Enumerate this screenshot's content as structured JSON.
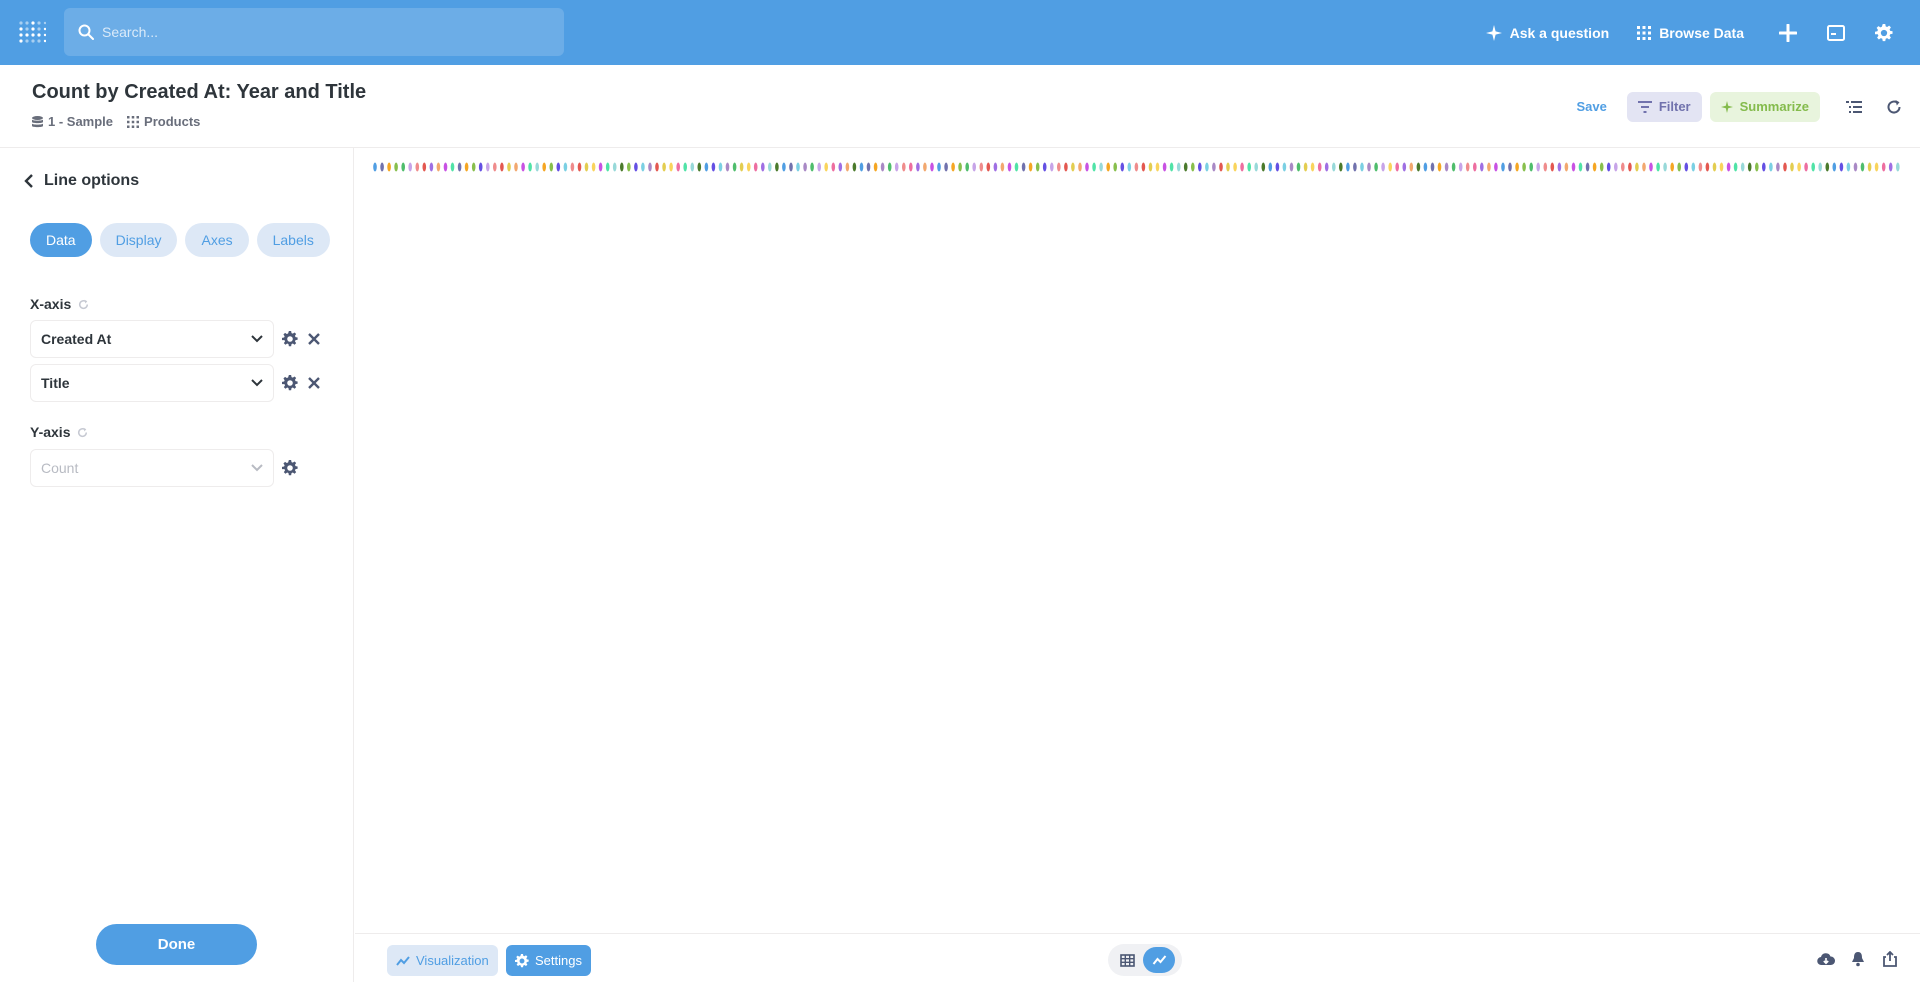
{
  "app": {
    "search_placeholder": "Search...",
    "ask_question": "Ask a question",
    "browse_data": "Browse Data",
    "brand_color": "#509ee3"
  },
  "question": {
    "title": "Count by Created At: Year and Title",
    "database": "1 - Sample",
    "table": "Products",
    "save_label": "Save",
    "filter_label": "Filter",
    "summarize_label": "Summarize"
  },
  "sidebar": {
    "heading": "Line options",
    "tabs": [
      {
        "label": "Data",
        "active": true
      },
      {
        "label": "Display",
        "active": false
      },
      {
        "label": "Axes",
        "active": false
      },
      {
        "label": "Labels",
        "active": false
      }
    ],
    "x_axis_label": "X-axis",
    "x_axis_fields": [
      "Created At",
      "Title"
    ],
    "y_axis_label": "Y-axis",
    "y_axis_field": "Count",
    "done_label": "Done"
  },
  "footer": {
    "visualization_label": "Visualization",
    "settings_label": "Settings"
  },
  "legend": {
    "colors": [
      "#509ee3",
      "#88bf4d",
      "#a989c5",
      "#ef8c8c",
      "#f9d45c",
      "#f2a86f",
      "#98d9d9",
      "#7172ad",
      "#6450e3",
      "#4fbd6c",
      "#e35850",
      "#ed6ea0",
      "#c852e3",
      "#4b7a2c",
      "#f5a623",
      "#7bd0e3",
      "#c7a4e8",
      "#e3cd50",
      "#9f6fe3",
      "#50e3a7"
    ]
  }
}
